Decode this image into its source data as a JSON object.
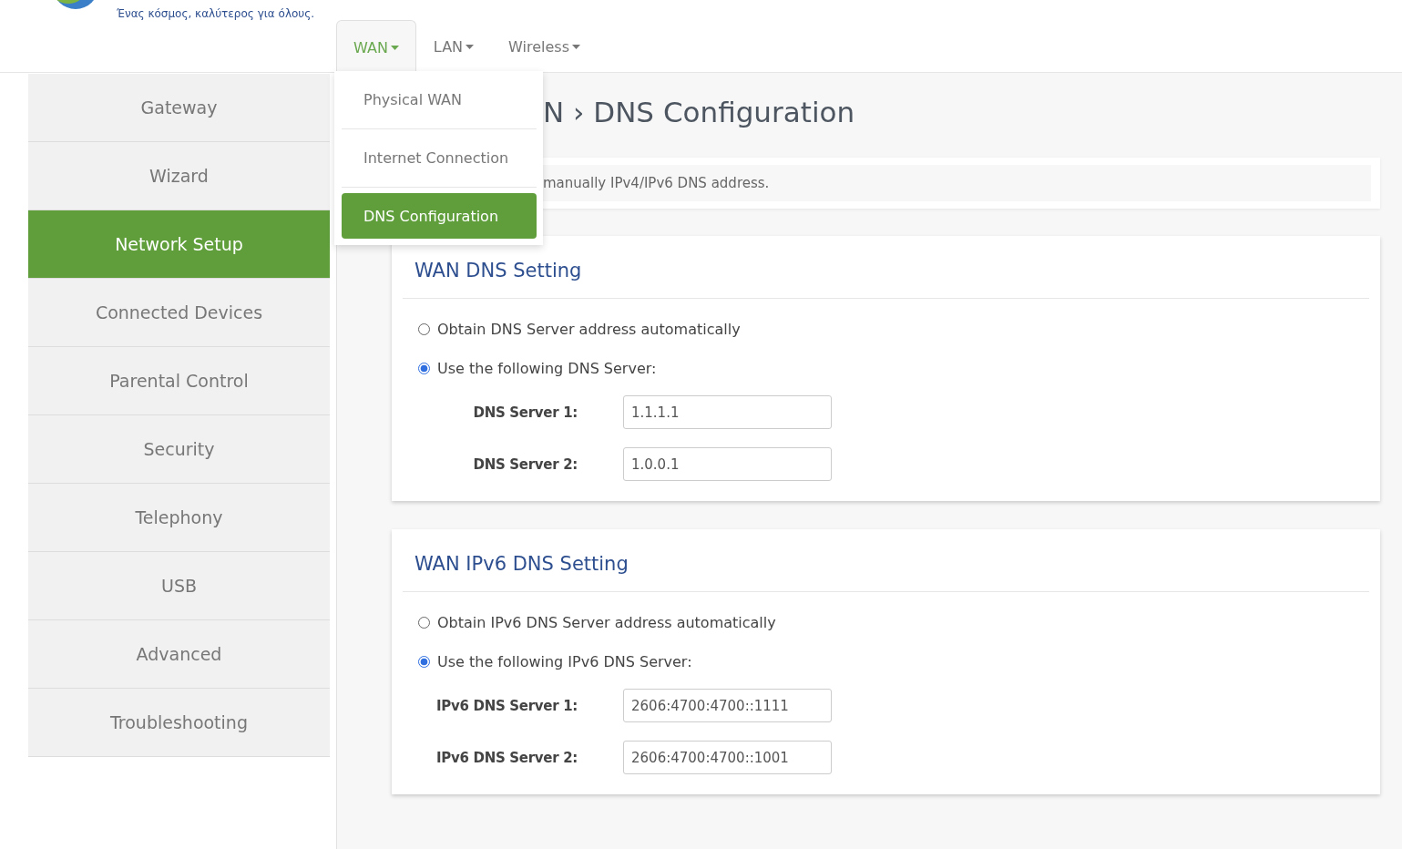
{
  "header": {
    "tagline": "Ένας κόσμος, καλύτερος για όλους."
  },
  "tabs": [
    {
      "label": "WAN",
      "selected": true
    },
    {
      "label": "LAN",
      "selected": false
    },
    {
      "label": "Wireless",
      "selected": false
    }
  ],
  "dropdown": [
    {
      "label": "Physical WAN",
      "selected": false
    },
    {
      "label": "Internet Connection",
      "selected": false
    },
    {
      "label": "DNS Configuration",
      "selected": true
    }
  ],
  "sidebar": {
    "items": [
      {
        "label": "Gateway",
        "selected": false
      },
      {
        "label": "Wizard",
        "selected": false
      },
      {
        "label": "Network Setup",
        "selected": true
      },
      {
        "label": "Connected Devices",
        "selected": false
      },
      {
        "label": "Parental Control",
        "selected": false
      },
      {
        "label": "Security",
        "selected": false
      },
      {
        "label": "Telephony",
        "selected": false
      },
      {
        "label": "USB",
        "selected": false
      },
      {
        "label": "Advanced",
        "selected": false
      },
      {
        "label": "Troubleshooting",
        "selected": false
      }
    ]
  },
  "page": {
    "title": "N › DNS Configuration",
    "description": "manually IPv4/IPv6 DNS address."
  },
  "cards": [
    {
      "title": "WAN DNS Setting",
      "options": [
        {
          "label": "Obtain DNS Server address automatically",
          "selected": false
        },
        {
          "label": "Use the following DNS Server:",
          "selected": true
        }
      ],
      "fields": [
        {
          "label": "DNS Server 1:",
          "value": "1.1.1.1"
        },
        {
          "label": "DNS Server 2:",
          "value": "1.0.0.1"
        }
      ]
    },
    {
      "title": "WAN IPv6 DNS Setting",
      "options": [
        {
          "label": "Obtain IPv6 DNS Server address automatically",
          "selected": false
        },
        {
          "label": "Use the following IPv6 DNS Server:",
          "selected": true
        }
      ],
      "fields": [
        {
          "label": "IPv6 DNS Server 1:",
          "value": "2606:4700:4700::1111"
        },
        {
          "label": "IPv6 DNS Server 2:",
          "value": "2606:4700:4700::1001"
        }
      ]
    }
  ]
}
